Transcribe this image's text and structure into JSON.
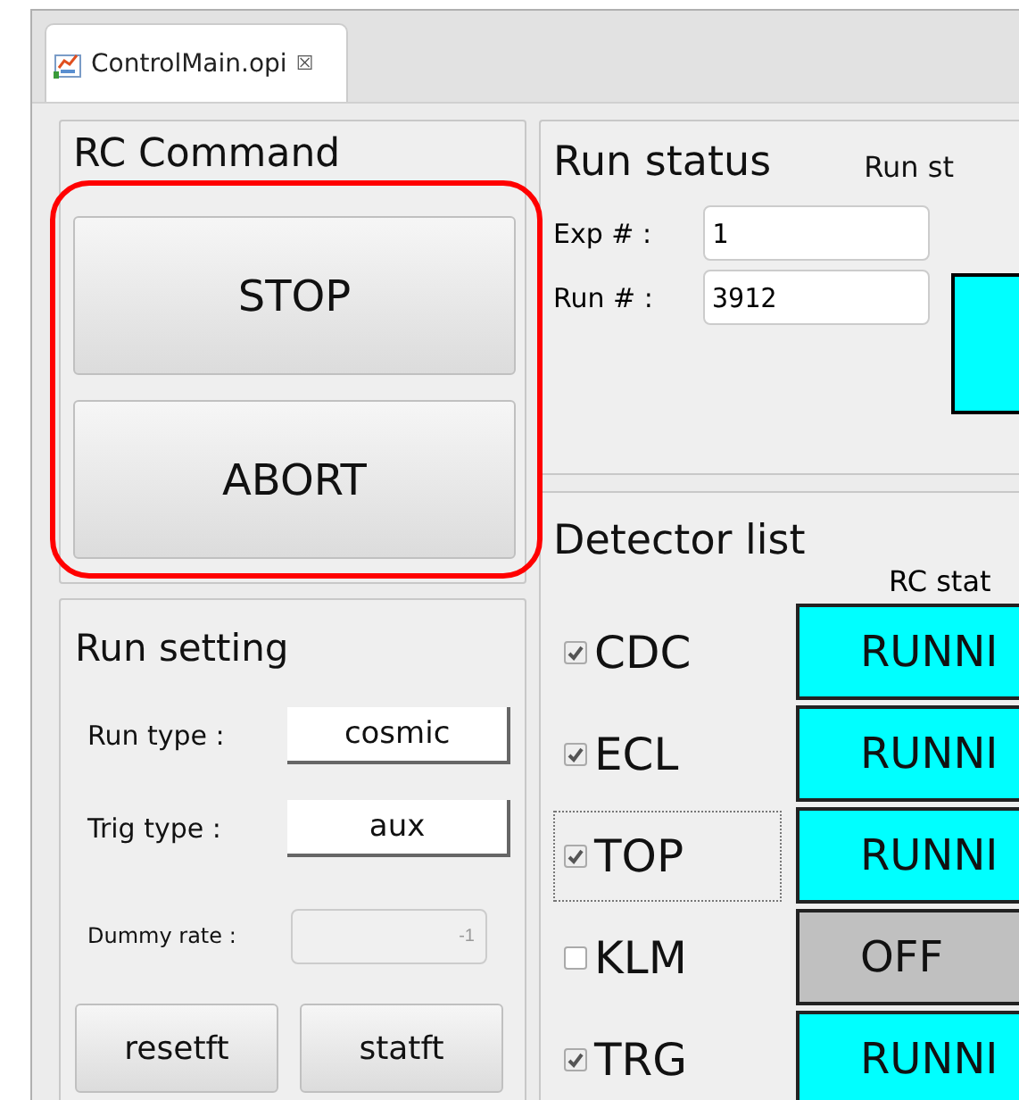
{
  "editor_tab": {
    "title": "ControlMain.opi",
    "close": "☒"
  },
  "rc_command": {
    "title": "RC Command",
    "buttons": [
      "STOP",
      "ABORT"
    ],
    "highlighted": true
  },
  "run_setting": {
    "title": "Run setting",
    "selectors": [
      {
        "label": "Run type :",
        "value": "cosmic"
      },
      {
        "label": "Trig type :",
        "value": "aux"
      }
    ],
    "dummy_rate": {
      "label": "Dummy rate :",
      "value": "-1",
      "disabled": true
    },
    "buttons": [
      "resetft",
      "statft"
    ]
  },
  "run_status": {
    "title": "Run status",
    "state_label": "Run st",
    "fields": [
      {
        "label": "Exp # :",
        "value": "1"
      },
      {
        "label": "Run # :",
        "value": "3912"
      }
    ]
  },
  "detector_list": {
    "title": "Detector list",
    "column_header": "RC stat",
    "detectors": [
      {
        "name": "CDC",
        "checked": true,
        "focused": false,
        "state": "RUNNI",
        "color": "#00ffff"
      },
      {
        "name": "ECL",
        "checked": true,
        "focused": false,
        "state": "RUNNI",
        "color": "#00ffff"
      },
      {
        "name": "TOP",
        "checked": true,
        "focused": true,
        "state": "RUNNI",
        "color": "#00ffff"
      },
      {
        "name": "KLM",
        "checked": false,
        "focused": false,
        "state": "OFF",
        "color": "#c0c0c0"
      },
      {
        "name": "TRG",
        "checked": true,
        "focused": false,
        "state": "RUNNI",
        "color": "#00ffff"
      }
    ]
  }
}
